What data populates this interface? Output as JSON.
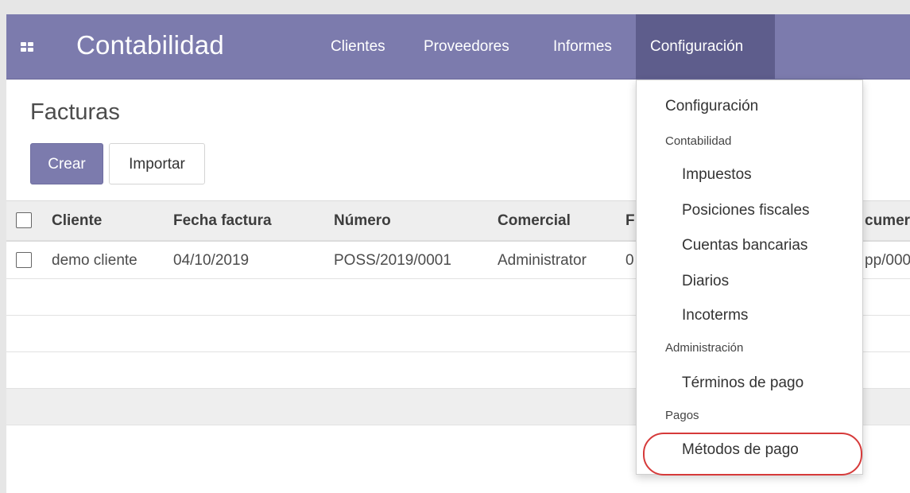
{
  "navbar": {
    "apps_icon": "apps-grid-icon",
    "brand": "Contabilidad",
    "menu": [
      "Clientes",
      "Proveedores",
      "Informes",
      "Configuración"
    ],
    "active_menu": "Configuración",
    "color": "#7c7bad",
    "active_color": "#5e5d8c"
  },
  "control_panel": {
    "title": "Facturas",
    "create_label": "Crear",
    "import_label": "Importar"
  },
  "table": {
    "columns": [
      "Cliente",
      "Fecha factura",
      "Número",
      "Comercial",
      "F",
      "cumer"
    ],
    "rows": [
      {
        "cliente": "demo cliente",
        "fecha": "04/10/2019",
        "numero": "POSS/2019/0001",
        "comercial": "Administrator",
        "partial_left": "0",
        "partial_right": "pp/000"
      }
    ]
  },
  "dropdown": {
    "items": {
      "configuracion": "Configuración",
      "h_contabilidad": "Contabilidad",
      "impuestos": "Impuestos",
      "posiciones": "Posiciones fiscales",
      "cuentas": "Cuentas bancarias",
      "diarios": "Diarios",
      "incoterms": "Incoterms",
      "h_administracion": "Administración",
      "terminos": "Términos de pago",
      "h_pagos": "Pagos",
      "metodos": "Métodos de pago"
    },
    "highlight_color": "#d63a3a"
  }
}
